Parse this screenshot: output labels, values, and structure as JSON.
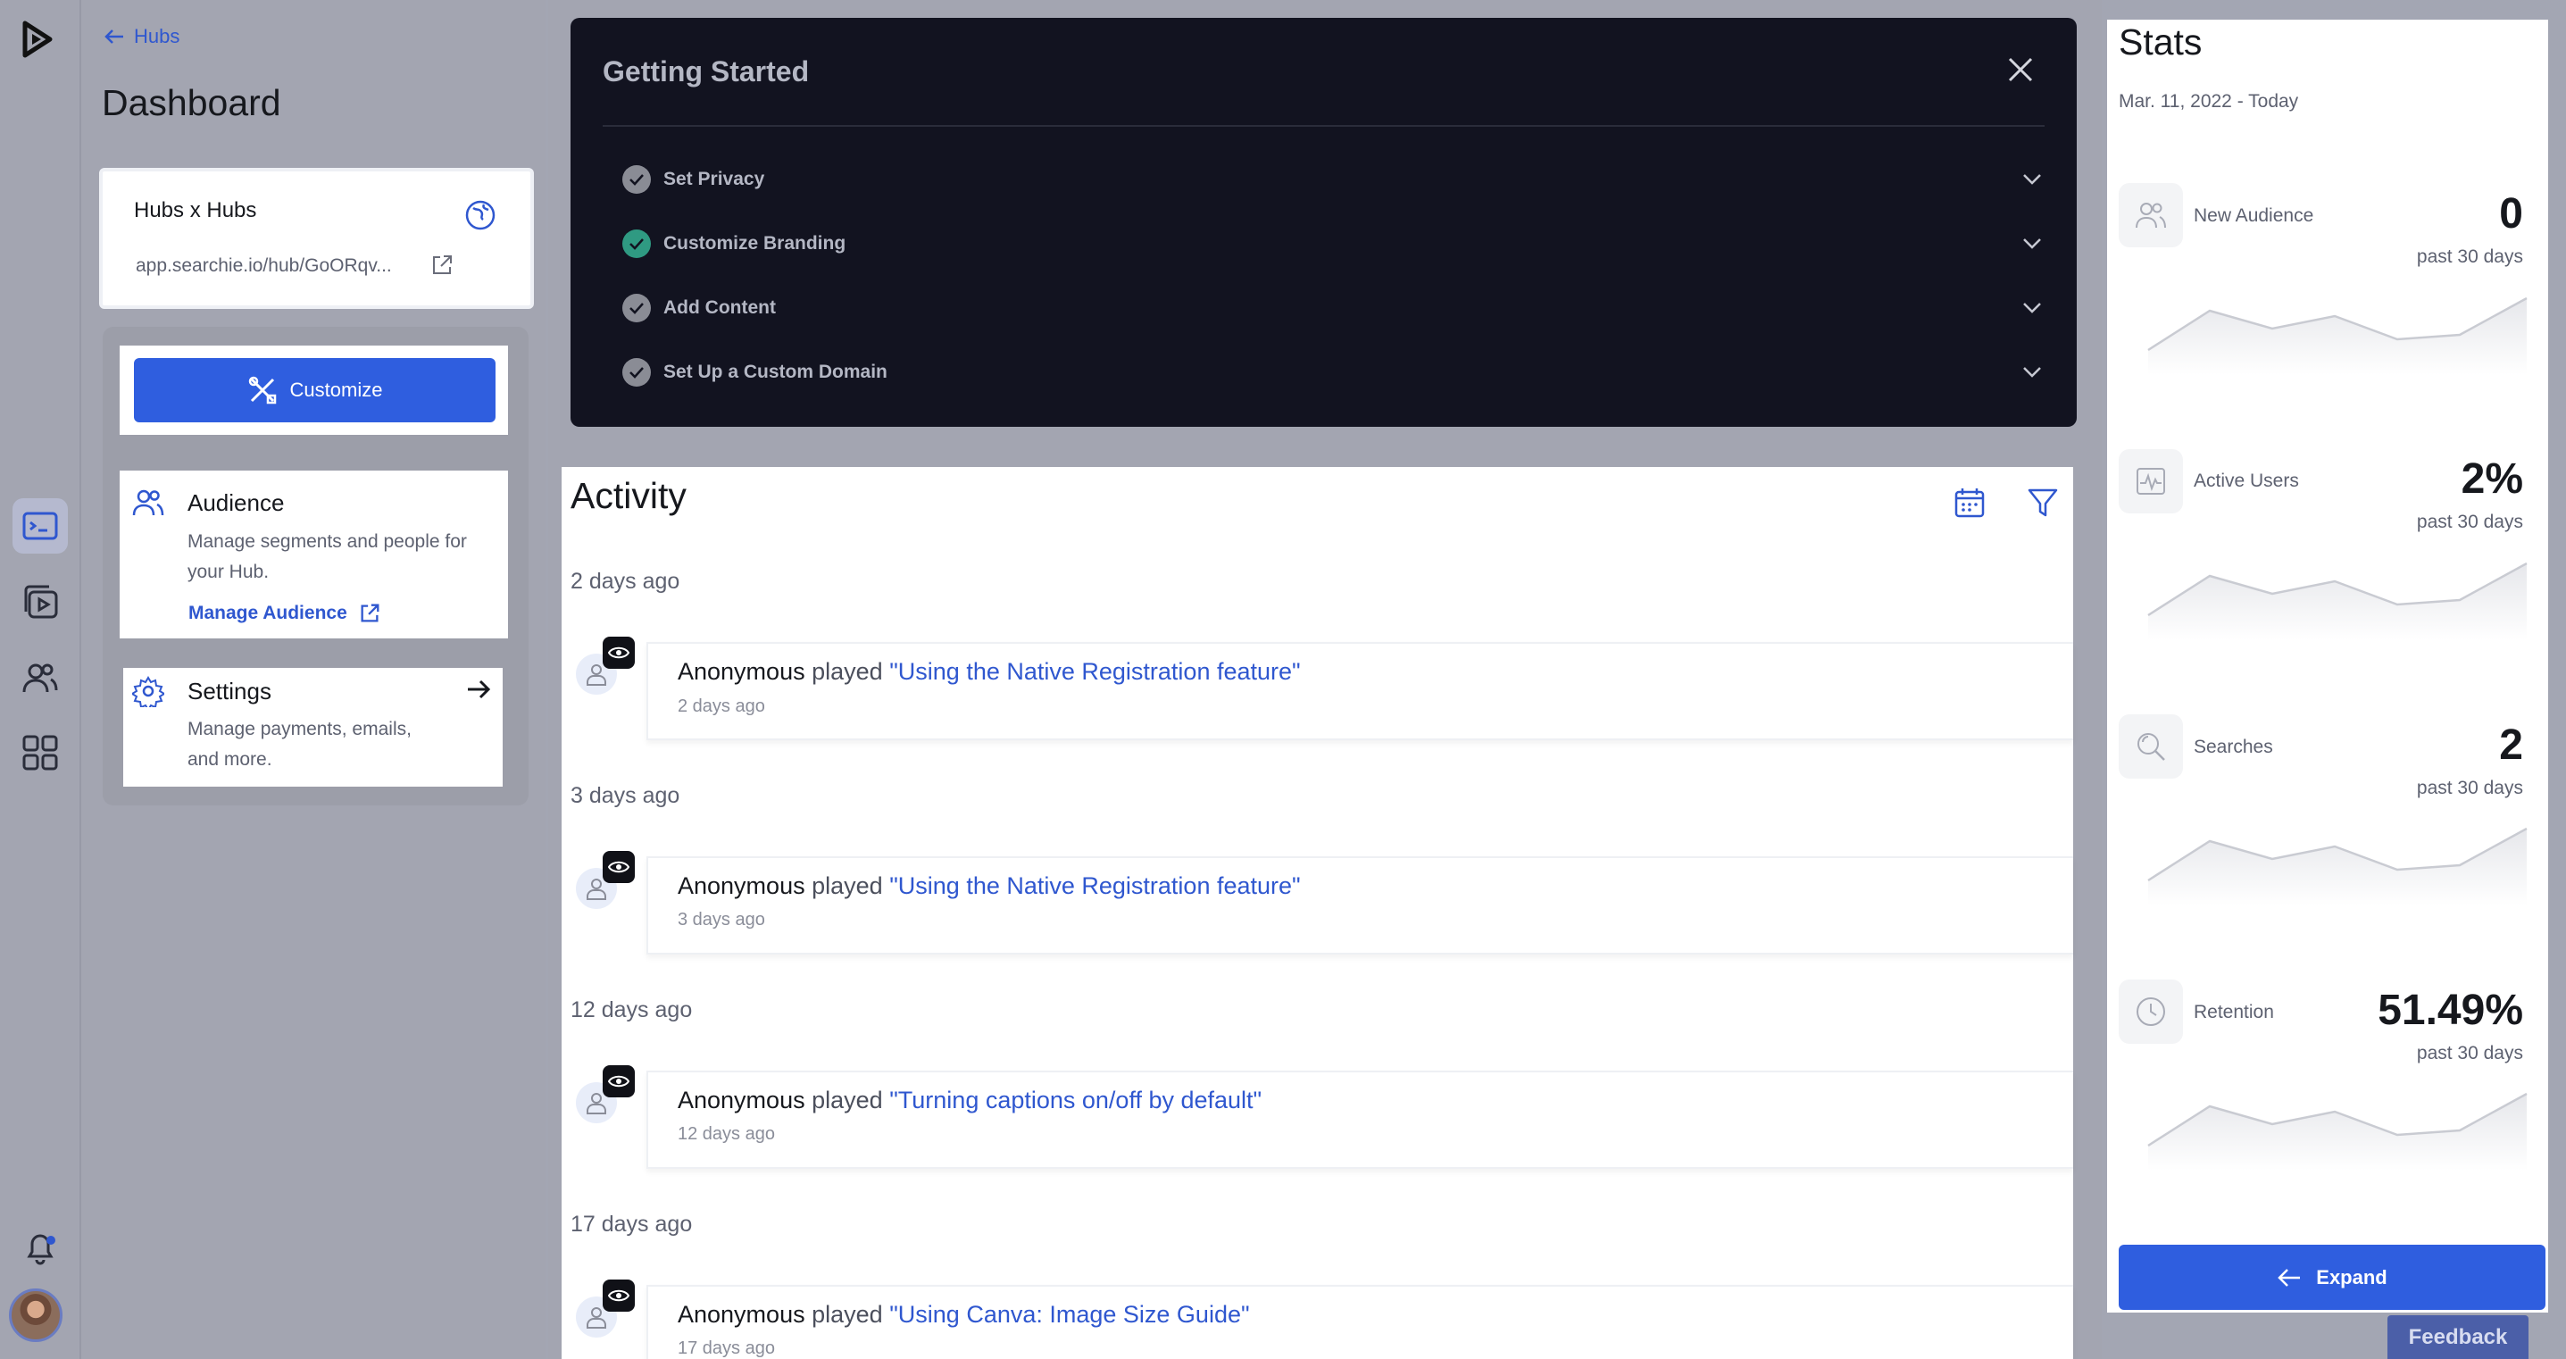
{
  "nav": {
    "back_label": "Hubs",
    "page_title": "Dashboard"
  },
  "hub": {
    "name": "Hubs x Hubs",
    "url": "app.searchie.io/hub/GoORqv..."
  },
  "side_cards": {
    "customize_label": "Customize",
    "audience": {
      "title": "Audience",
      "desc_line1": "Manage segments and people for",
      "desc_line2": "your Hub.",
      "link": "Manage Audience"
    },
    "settings": {
      "title": "Settings",
      "desc_line1": "Manage payments, emails,",
      "desc_line2": "and more."
    }
  },
  "getting_started": {
    "title": "Getting Started",
    "steps": [
      {
        "label": "Set Privacy",
        "done": false
      },
      {
        "label": "Customize Branding",
        "done": true
      },
      {
        "label": "Add Content",
        "done": false
      },
      {
        "label": "Set Up a Custom Domain",
        "done": false
      }
    ]
  },
  "activity": {
    "title": "Activity",
    "groups": [
      {
        "day": "2 days ago",
        "user": "Anonymous",
        "verb": "played",
        "video": "\"Using the Native Registration feature\"",
        "time": "2 days ago"
      },
      {
        "day": "3 days ago",
        "user": "Anonymous",
        "verb": "played",
        "video": "\"Using the Native Registration feature\"",
        "time": "3 days ago"
      },
      {
        "day": "12 days ago",
        "user": "Anonymous",
        "verb": "played",
        "video": "\"Turning captions on/off by default\"",
        "time": "12 days ago"
      },
      {
        "day": "17 days ago",
        "user": "Anonymous",
        "verb": "played",
        "video": "\"Using Canva: Image Size Guide\"",
        "time": "17 days ago"
      }
    ]
  },
  "stats": {
    "title": "Stats",
    "date_range": "Mar. 11, 2022 - Today",
    "items": [
      {
        "label": "New Audience",
        "value": "0",
        "sub": "past 30 days",
        "icon": "users-icon"
      },
      {
        "label": "Active Users",
        "value": "2%",
        "sub": "past 30 days",
        "icon": "pulse-icon"
      },
      {
        "label": "Searches",
        "value": "2",
        "sub": "past 30 days",
        "icon": "search-icon"
      },
      {
        "label": "Retention",
        "value": "51.49%",
        "sub": "past 30 days",
        "icon": "clock-icon"
      }
    ],
    "expand_label": "Expand"
  },
  "feedback_label": "Feedback",
  "colors": {
    "accent": "#2f5edf",
    "link": "#2f57cf",
    "done_check": "#2f9a82",
    "dark_panel": "#121320"
  }
}
